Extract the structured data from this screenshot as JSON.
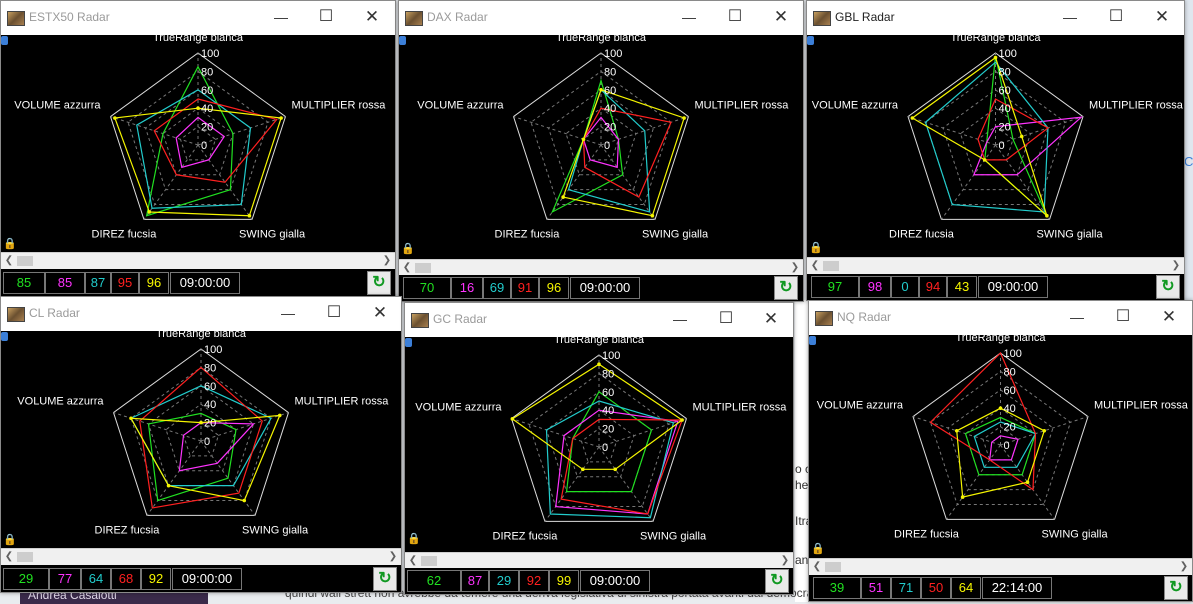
{
  "background": {
    "user_name": "Andrea Casalotti",
    "text_bottom": "quindi wall strett non avrebbe da temere una deriva legislativa di sinistra portata avanti dai democrati",
    "fragments": [
      "o c",
      "he",
      "Itra",
      "an",
      "C"
    ]
  },
  "axes": {
    "top": "TrueRange bianca",
    "right": "MULTIPLIER rossa",
    "bottom_right": "SWING gialla",
    "bottom_left": "DIREZ fucsia",
    "left": "VOLUME azzurra"
  },
  "ticks": [
    "100",
    "80",
    "60",
    "40",
    "20",
    "0"
  ],
  "colors": {
    "green": "#21e021",
    "magenta": "#ff33ff",
    "cyan": "#22cccc",
    "red": "#ff2020",
    "yellow": "#f5f500",
    "white": "#ffffff"
  },
  "icons": {
    "close": "close-icon",
    "minimize": "minimize-icon",
    "maximize": "maximize-icon",
    "refresh": "refresh-icon",
    "lock": "lock-icon"
  },
  "windows": [
    {
      "title": "ESTX50 Radar",
      "values": [
        "85",
        "85",
        "87",
        "95",
        "96"
      ],
      "time": "09:00:00",
      "chart_data": {
        "type": "radar",
        "axes": [
          "TrueRange bianca",
          "MULTIPLIER rossa",
          "SWING gialla",
          "DIREZ fucsia",
          "VOLUME azzurra"
        ],
        "rlim": [
          0,
          100
        ],
        "series": [
          {
            "color": "#21e021",
            "values": [
              85,
              40,
              60,
              95,
              40
            ]
          },
          {
            "color": "#ff33ff",
            "values": [
              30,
              30,
              20,
              30,
              25
            ]
          },
          {
            "color": "#22cccc",
            "values": [
              60,
              60,
              80,
              85,
              70
            ]
          },
          {
            "color": "#ff2020",
            "values": [
              50,
              90,
              50,
              40,
              50
            ]
          },
          {
            "color": "#f5f500",
            "values": [
              40,
              95,
              95,
              90,
              95
            ]
          }
        ]
      }
    },
    {
      "title": "DAX Radar",
      "values": [
        "70",
        "16",
        "69",
        "91",
        "96"
      ],
      "time": "09:00:00",
      "chart_data": {
        "type": "radar",
        "axes": [
          "TrueRange bianca",
          "MULTIPLIER rossa",
          "SWING gialla",
          "DIREZ fucsia",
          "VOLUME azzurra"
        ],
        "rlim": [
          0,
          100
        ],
        "series": [
          {
            "color": "#21e021",
            "values": [
              70,
              20,
              40,
              90,
              20
            ]
          },
          {
            "color": "#ff33ff",
            "values": [
              30,
              20,
              30,
              20,
              20
            ]
          },
          {
            "color": "#22cccc",
            "values": [
              60,
              50,
              90,
              60,
              20
            ]
          },
          {
            "color": "#ff2020",
            "values": [
              40,
              80,
              70,
              30,
              20
            ]
          },
          {
            "color": "#f5f500",
            "values": [
              60,
              95,
              95,
              70,
              20
            ]
          }
        ]
      }
    },
    {
      "title": "GBL Radar",
      "values": [
        "97",
        "98",
        "0",
        "94",
        "43"
      ],
      "time": "09:00:00",
      "chart_data": {
        "type": "radar",
        "axes": [
          "TrueRange bianca",
          "MULTIPLIER rossa",
          "SWING gialla",
          "DIREZ fucsia",
          "VOLUME azzurra"
        ],
        "rlim": [
          0,
          100
        ],
        "series": [
          {
            "color": "#21e021",
            "values": [
              97,
              20,
              95,
              20,
              10
            ]
          },
          {
            "color": "#ff33ff",
            "values": [
              20,
              98,
              40,
              40,
              10
            ]
          },
          {
            "color": "#22cccc",
            "values": [
              90,
              60,
              90,
              80,
              80
            ]
          },
          {
            "color": "#ff2020",
            "values": [
              50,
              60,
              20,
              20,
              20
            ]
          },
          {
            "color": "#f5f500",
            "values": [
              95,
              30,
              95,
              20,
              95
            ]
          }
        ]
      }
    },
    {
      "title": "CL Radar",
      "values": [
        "29",
        "77",
        "64",
        "68",
        "92"
      ],
      "time": "09:00:00",
      "chart_data": {
        "type": "radar",
        "axes": [
          "TrueRange bianca",
          "MULTIPLIER rossa",
          "SWING gialla",
          "DIREZ fucsia",
          "VOLUME azzurra"
        ],
        "rlim": [
          0,
          100
        ],
        "series": [
          {
            "color": "#21e021",
            "values": [
              30,
              40,
              50,
              80,
              60
            ]
          },
          {
            "color": "#ff33ff",
            "values": [
              20,
              60,
              30,
              40,
              20
            ]
          },
          {
            "color": "#22cccc",
            "values": [
              60,
              80,
              60,
              60,
              80
            ]
          },
          {
            "color": "#ff2020",
            "values": [
              80,
              70,
              70,
              90,
              70
            ]
          },
          {
            "color": "#f5f500",
            "values": [
              20,
              90,
              80,
              60,
              80
            ]
          }
        ]
      }
    },
    {
      "title": "GC Radar",
      "values": [
        "62",
        "87",
        "29",
        "92",
        "99"
      ],
      "time": "09:00:00",
      "chart_data": {
        "type": "radar",
        "axes": [
          "TrueRange bianca",
          "MULTIPLIER rossa",
          "SWING gialla",
          "DIREZ fucsia",
          "VOLUME azzurra"
        ],
        "rlim": [
          0,
          100
        ],
        "series": [
          {
            "color": "#21e021",
            "values": [
              60,
              60,
              60,
              60,
              30
            ]
          },
          {
            "color": "#ff33ff",
            "values": [
              40,
              90,
              90,
              80,
              40
            ]
          },
          {
            "color": "#22cccc",
            "values": [
              50,
              85,
              95,
              90,
              60
            ]
          },
          {
            "color": "#ff2020",
            "values": [
              30,
              95,
              90,
              70,
              30
            ]
          },
          {
            "color": "#f5f500",
            "values": [
              90,
              95,
              30,
              30,
              99
            ]
          }
        ]
      }
    },
    {
      "title": "NQ Radar",
      "values": [
        "39",
        "51",
        "71",
        "50",
        "64"
      ],
      "time": "22:14:00",
      "chart_data": {
        "type": "radar",
        "axes": [
          "TrueRange bianca",
          "MULTIPLIER rossa",
          "SWING gialla",
          "DIREZ fucsia",
          "VOLUME azzurra"
        ],
        "rlim": [
          0,
          100
        ],
        "series": [
          {
            "color": "#21e021",
            "values": [
              30,
              40,
              40,
              40,
              40
            ]
          },
          {
            "color": "#ff33ff",
            "values": [
              10,
              20,
              20,
              20,
              10
            ]
          },
          {
            "color": "#22cccc",
            "values": [
              25,
              40,
              30,
              30,
              30
            ]
          },
          {
            "color": "#ff2020",
            "values": [
              100,
              40,
              60,
              20,
              80
            ]
          },
          {
            "color": "#f5f500",
            "values": [
              40,
              50,
              50,
              70,
              50
            ]
          }
        ]
      }
    }
  ]
}
